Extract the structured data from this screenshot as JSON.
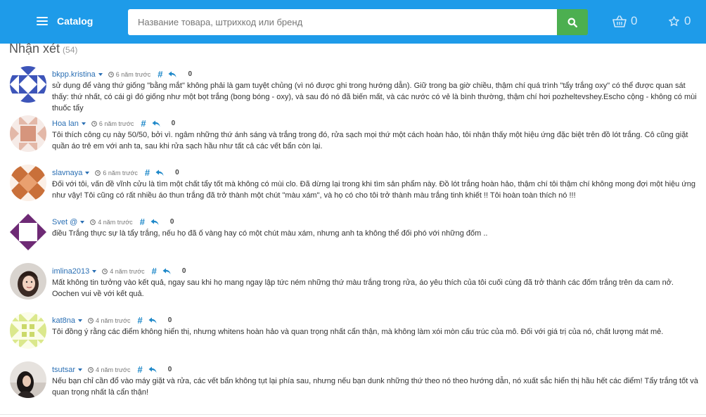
{
  "header": {
    "brand": "Catalog",
    "search_placeholder": "Название товара, штрихкод или бренд",
    "cart_count": "0",
    "favorites_count": "0"
  },
  "colors": {
    "topbar": "#1e9be9",
    "search_button": "#4caf50",
    "link": "#2a6fb4",
    "hash": "#1e88c9"
  },
  "section": {
    "title": "Nhận xét",
    "count": "(54)"
  },
  "comments": [
    {
      "author": "bkpp.kristina",
      "time": "6 năm trước",
      "hash": "#",
      "votes": "0",
      "text": "sử dụng để vàng thứ giống \"bằng mắt\" không phải là gam tuyệt chủng (vì nó được ghi trong hướng dẫn). Giữ trong ba giờ chiều, thậm chí quá trình \"tẩy trắng oxy\" có thể được quan sát thấy: thứ nhất, có cái gì đó giống như một bọt trắng (bong bóng - oxy), và sau đó nó đã biến mất, và các nước có vẻ là bình thường, thậm chí hơi pozheltevshey.Escho cộng - không có mùi thuốc tẩy"
    },
    {
      "author": "Hoa lan",
      "time": "6 năm trước",
      "hash": "#",
      "votes": "0",
      "text": "Tôi thích công cụ này 50/50, bởi vì. ngâm những thứ ánh sáng và trắng trong đó, rửa sạch mọi thứ một cách hoàn hảo, tôi nhận thấy một hiệu ứng đặc biệt trên đồ lót trắng. Cô cũng giặt quần áo trẻ em với anh ta, sau khi rửa sạch hầu như tất cả các vết bẩn còn lại."
    },
    {
      "author": "slavnaya",
      "time": "6 năm trước",
      "hash": "#",
      "votes": "0",
      "text": "Đối với tôi, vấn đề vĩnh cửu là tìm một chất tẩy tốt mà không có mùi clo. Đã dừng lại trong khi tìm sản phẩm này. Đồ lót trắng hoàn hảo, thậm chí tôi thậm chí không mong đợi một hiệu ứng như vậy! Tôi cũng có rất nhiều áo thun trắng đã trở thành một chút \"màu xám\", và họ có cho tôi trở thành màu trắng tinh khiết !! Tôi hoàn toàn thích nó !!!"
    },
    {
      "author": "Svet @",
      "time": "4 năm trước",
      "hash": "#",
      "votes": "0",
      "text": "điều Trắng thực sự là tẩy trắng, nếu họ đã ố vàng hay có một chút màu xám, nhưng anh ta không thể đối phó với những đốm .."
    },
    {
      "author": "imlina2013",
      "time": "4 năm trước",
      "hash": "#",
      "votes": "0",
      "text": "Mất không tin tưởng vào kết quả, ngay sau khi họ mang ngay lập tức ném những thứ màu trắng trong rửa, áo yêu thích của tôi cuối cùng đã trở thành các đốm trắng trên da cam nở. Oochen vui về với kết quả."
    },
    {
      "author": "kat8na",
      "time": "4 năm trước",
      "hash": "#",
      "votes": "0",
      "text": "Tôi đồng ý rằng các điểm không hiển thị, nhưng whitens hoàn hảo và quan trọng nhất cẩn thận, mà không làm xói mòn cấu trúc của mô. Đối với giá trị của nó, chất lượng mát mẻ."
    },
    {
      "author": "tsutsar",
      "time": "4 năm trước",
      "hash": "#",
      "votes": "0",
      "text": "Nếu bạn chỉ cần đổ vào máy giặt và rửa, các vết bẩn không tụt lại phía sau, nhưng nếu bạn dunk những thứ theo nó theo hướng dẫn, nó xuất sắc hiển thị hầu hết các điểm! Tẩy trắng tốt và quan trọng nhất là cẩn thận!"
    }
  ]
}
